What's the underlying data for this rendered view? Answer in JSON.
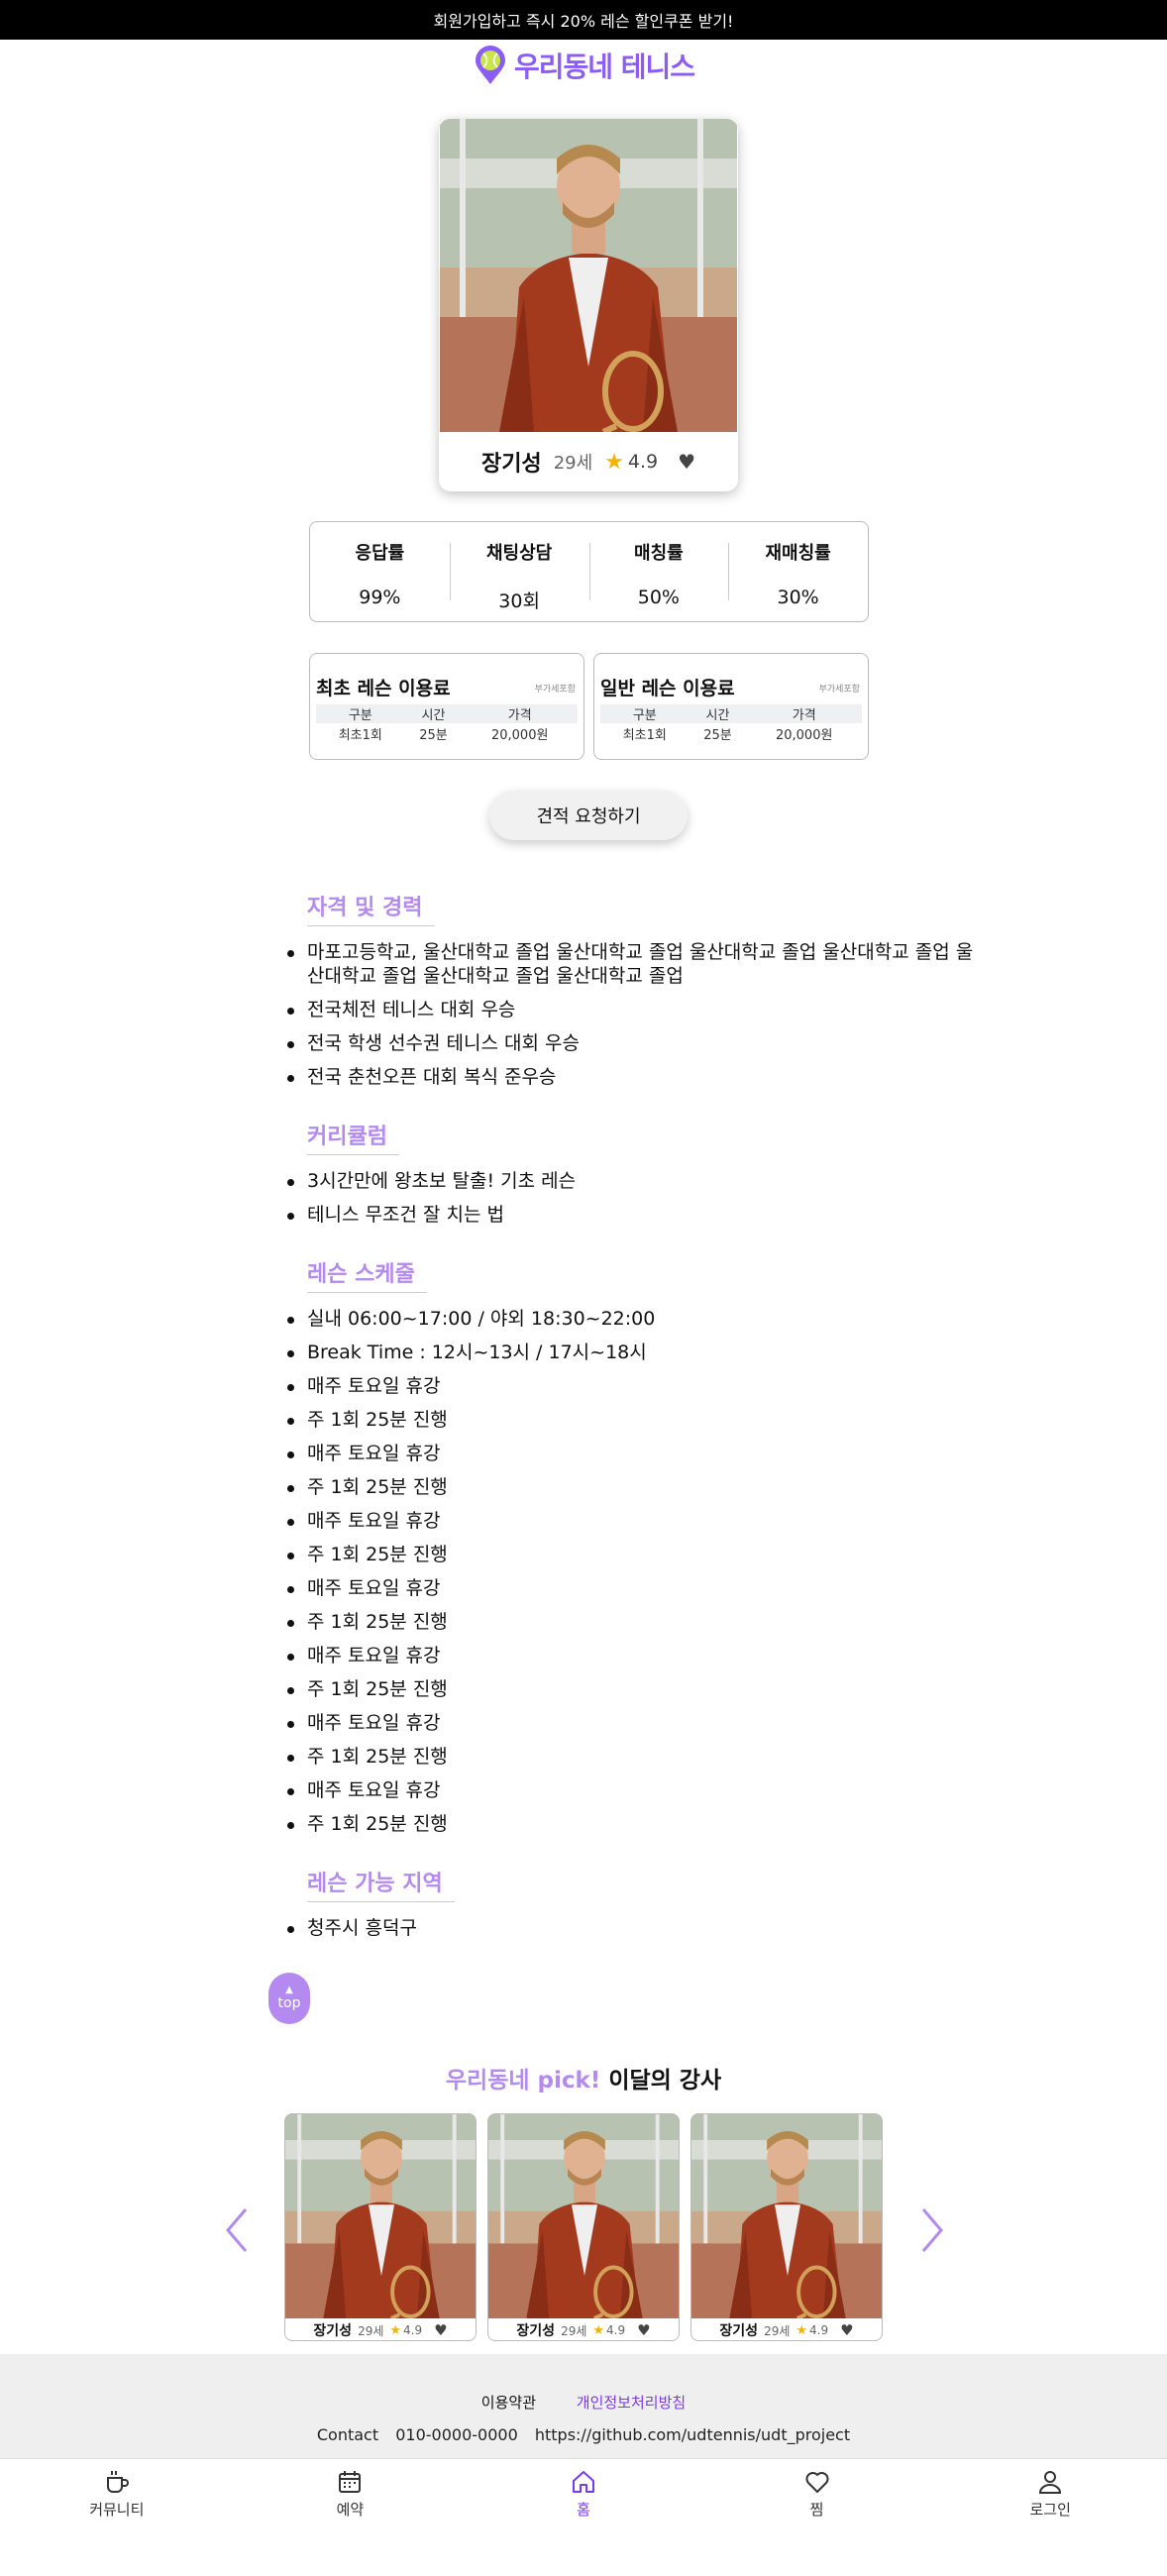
{
  "banner": {
    "text": "회원가입하고 즉시 20% 레슨 할인쿠폰 받기!"
  },
  "logo": {
    "text": "우리동네 테니스",
    "color": "#8b5cf6"
  },
  "profile": {
    "name": "장기성",
    "age": "29세",
    "rating": "4.9"
  },
  "stats": [
    {
      "label": "응답률",
      "value": "99%"
    },
    {
      "label": "채팅상담",
      "value": "30회"
    },
    {
      "label": "매칭률",
      "value": "50%"
    },
    {
      "label": "재매칭률",
      "value": "30%"
    }
  ],
  "prices": [
    {
      "title": "최초 레슨 이용료",
      "vat": "부가세포함",
      "headers": [
        "구분",
        "시간",
        "가격"
      ],
      "row": [
        "최초1회",
        "25분",
        "20,000원"
      ]
    },
    {
      "title": "일반 레슨 이용료",
      "vat": "부가세포함",
      "headers": [
        "구분",
        "시간",
        "가격"
      ],
      "row": [
        "최초1회",
        "25분",
        "20,000원"
      ]
    }
  ],
  "quote_button": "견적 요청하기",
  "sections": {
    "career": {
      "title": "자격 및 경력",
      "items": [
        "마포고등학교, 울산대학교 졸업 울산대학교 졸업 울산대학교 졸업 울산대학교 졸업 울산대학교 졸업 울산대학교 졸업 울산대학교 졸업",
        "전국체전 테니스 대회 우승",
        "전국 학생 선수권 테니스 대회 우승",
        "전국 춘천오픈 대회 복식 준우승"
      ]
    },
    "curriculum": {
      "title": "커리큘럼",
      "items": [
        "3시간만에 왕초보 탈출! 기초 레슨",
        "테니스 무조건 잘 치는 법"
      ]
    },
    "schedule": {
      "title": "레슨 스케줄",
      "items": [
        "실내 06:00~17:00 / 야외 18:30~22:00",
        "Break Time : 12시~13시 / 17시~18시",
        "매주 토요일 휴강",
        "주 1회 25분 진행",
        "매주 토요일 휴강",
        "주 1회 25분 진행",
        "매주 토요일 휴강",
        "주 1회 25분 진행",
        "매주 토요일 휴강",
        "주 1회 25분 진행",
        "매주 토요일 휴강",
        "주 1회 25분 진행",
        "매주 토요일 휴강",
        "주 1회 25분 진행",
        "매주 토요일 휴강",
        "주 1회 25분 진행"
      ]
    },
    "region": {
      "title": "레슨 가능 지역",
      "items": [
        "청주시 흥덕구"
      ]
    }
  },
  "top_button": "top",
  "pick": {
    "accent": "우리동네 pick!",
    "title": "이달의 강사",
    "cards": [
      {
        "name": "장기성",
        "age": "29세",
        "rating": "4.9"
      },
      {
        "name": "장기성",
        "age": "29세",
        "rating": "4.9"
      },
      {
        "name": "장기성",
        "age": "29세",
        "rating": "4.9"
      }
    ]
  },
  "footer": {
    "terms": "이용약관",
    "privacy": "개인정보처리방침",
    "contact_label": "Contact",
    "phone": "010-0000-0000",
    "github": "https://github.com/udtennis/udt_project"
  },
  "nav": [
    {
      "label": "커뮤니티",
      "icon": "coffee-cup-icon"
    },
    {
      "label": "예약",
      "icon": "calendar-icon"
    },
    {
      "label": "홈",
      "icon": "home-icon"
    },
    {
      "label": "찜",
      "icon": "heart-icon"
    },
    {
      "label": "로그인",
      "icon": "user-icon"
    }
  ],
  "colors": {
    "accent": "#b48af0",
    "brand": "#8b5cf6",
    "star": "#f5b400"
  }
}
